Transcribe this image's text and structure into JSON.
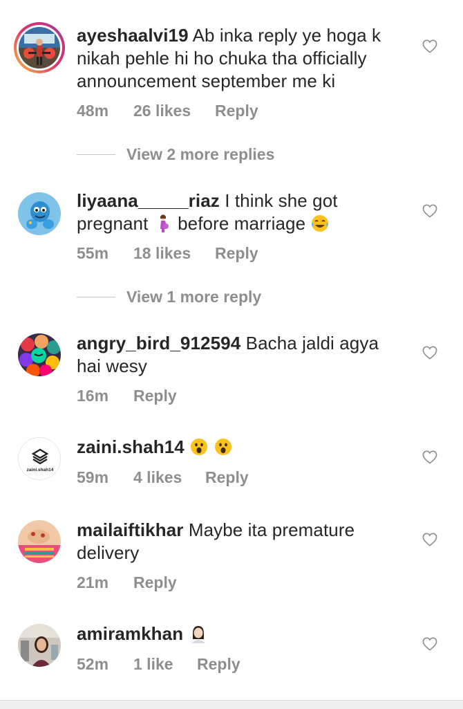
{
  "comments": [
    {
      "username": "ayeshaalvi19",
      "text": "Ab inka reply ye hoga k nikah pehle hi ho chuka tha officially announcement september me ki",
      "time": "48m",
      "likes": "26 likes",
      "reply": "Reply",
      "view_more": "View 2 more replies"
    },
    {
      "username": "liyaana_____riaz",
      "text_a": "I think she got pregnant",
      "text_b": "before marriage",
      "time": "55m",
      "likes": "18 likes",
      "reply": "Reply",
      "view_more": "View 1 more reply"
    },
    {
      "username": "angry_bird_912594",
      "text": "Bacha jaldi agya hai wesy",
      "time": "16m",
      "reply": "Reply"
    },
    {
      "username": "zaini.shah14",
      "avatar_text": "zaini.shah14",
      "time": "59m",
      "likes": "4 likes",
      "reply": "Reply"
    },
    {
      "username": "mailaiftikhar",
      "text": "Maybe ita premature delivery",
      "time": "21m",
      "reply": "Reply"
    },
    {
      "username": "amiramkhan",
      "time": "52m",
      "likes": "1 like",
      "reply": "Reply"
    }
  ],
  "icons": {
    "like": "heart-outline-icon",
    "pregnant": "pregnant-woman-emoji",
    "laugh": "tears-of-joy-emoji",
    "surprised": "surprised-face-emoji",
    "facepalm": "woman-facepalming-emoji"
  },
  "colors": {
    "text": "#262626",
    "secondary": "#8e8e8e",
    "divider": "#c7c7c7"
  }
}
